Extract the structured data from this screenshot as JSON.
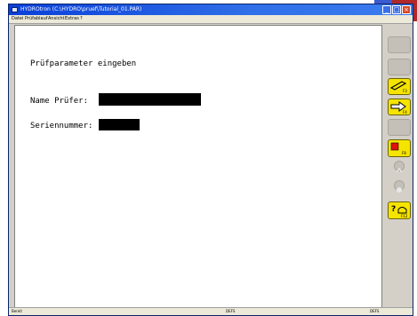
{
  "window": {
    "title": "HYDROtron (C:\\HYDRO\\pruef\\Tutorial_01.PAR)",
    "controls": {
      "minimize": "_",
      "maximize": "□",
      "close": "×"
    }
  },
  "menu": [
    "Datei",
    "Prüfablauf",
    "Ansicht",
    "Extras",
    "?"
  ],
  "form": {
    "heading": "Prüfparameter eingeben",
    "name_label": "Name Prüfer:",
    "serial_label": "Seriennummer:"
  },
  "toolbar": [
    {
      "icon": "blank-icon",
      "enabled": false
    },
    {
      "icon": "blank-icon",
      "enabled": false
    },
    {
      "icon": "edit-icon",
      "enabled": true,
      "caption": "F3"
    },
    {
      "icon": "arrow-right-icon",
      "enabled": true,
      "caption": "F4"
    },
    {
      "icon": "blank-icon",
      "enabled": false
    },
    {
      "icon": "stop-icon",
      "enabled": true,
      "caption": "F8"
    },
    {
      "icon": "up-icon",
      "enabled": false
    },
    {
      "icon": "info-icon",
      "enabled": false
    },
    {
      "icon": "help-icon",
      "enabled": true,
      "caption": "F12"
    }
  ],
  "status": {
    "left": "Bereit",
    "middle": "DEFS",
    "right": "DEFS"
  }
}
